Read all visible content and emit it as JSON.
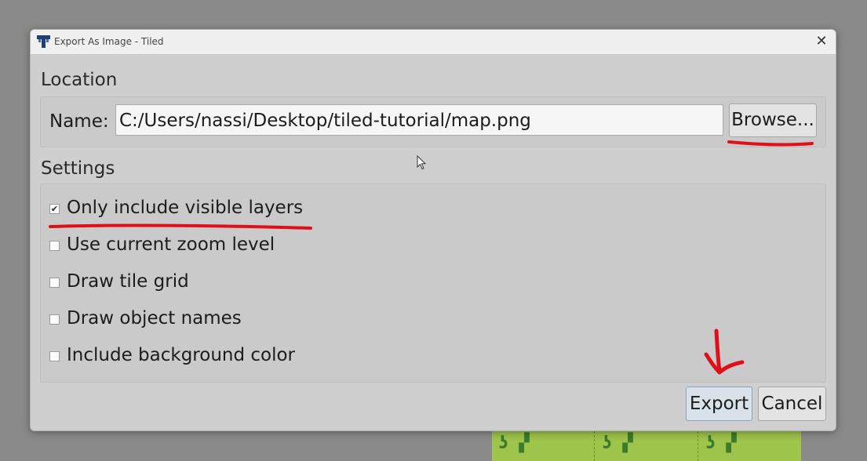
{
  "window": {
    "title": "Export As Image - Tiled",
    "close_glyph": "✕"
  },
  "location": {
    "section_label": "Location",
    "name_label": "Name:",
    "name_value": "C:/Users/nassi/Desktop/tiled-tutorial/map.png",
    "browse_label": "Browse..."
  },
  "settings": {
    "section_label": "Settings",
    "options": [
      {
        "label": "Only include visible layers",
        "checked": true
      },
      {
        "label": "Use current zoom level",
        "checked": false
      },
      {
        "label": "Draw tile grid",
        "checked": false
      },
      {
        "label": "Draw object names",
        "checked": false
      },
      {
        "label": "Include background color",
        "checked": false
      }
    ]
  },
  "buttons": {
    "export_label": "Export",
    "cancel_label": "Cancel"
  },
  "colors": {
    "annotation_red": "#e0101a",
    "dialog_bg": "#cfcfcf",
    "titlebar_bg": "#f0f0f0"
  },
  "icons": {
    "app": "tiled-logo-icon",
    "close": "close-icon",
    "cursor": "mouse-pointer-icon"
  }
}
